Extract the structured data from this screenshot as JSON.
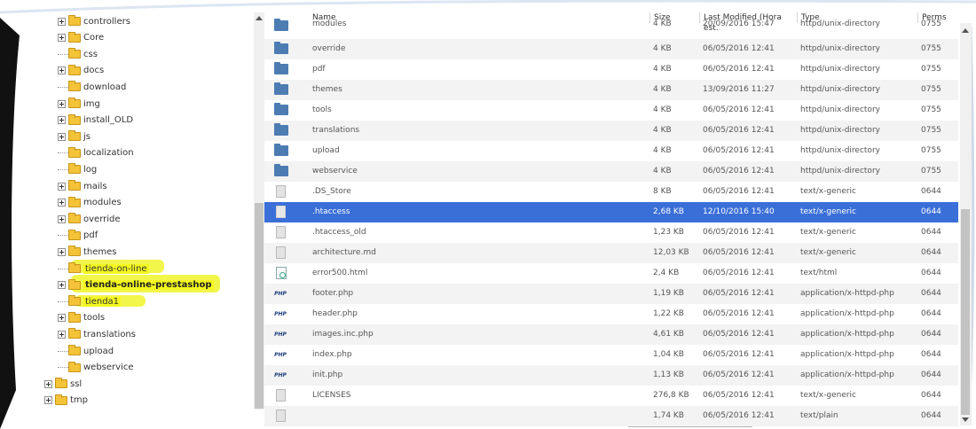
{
  "tree": {
    "items": [
      {
        "label": "controllers",
        "expandable": true,
        "state": "normal"
      },
      {
        "label": "Core",
        "expandable": true,
        "state": "normal"
      },
      {
        "label": "css",
        "expandable": false,
        "state": "normal"
      },
      {
        "label": "docs",
        "expandable": true,
        "state": "normal"
      },
      {
        "label": "download",
        "expandable": false,
        "state": "normal"
      },
      {
        "label": "img",
        "expandable": true,
        "state": "normal"
      },
      {
        "label": "install_OLD",
        "expandable": true,
        "state": "normal"
      },
      {
        "label": "js",
        "expandable": true,
        "state": "normal"
      },
      {
        "label": "localization",
        "expandable": false,
        "state": "normal"
      },
      {
        "label": "log",
        "expandable": false,
        "state": "normal"
      },
      {
        "label": "mails",
        "expandable": true,
        "state": "normal"
      },
      {
        "label": "modules",
        "expandable": true,
        "state": "normal"
      },
      {
        "label": "override",
        "expandable": true,
        "state": "normal"
      },
      {
        "label": "pdf",
        "expandable": false,
        "state": "normal"
      },
      {
        "label": "themes",
        "expandable": true,
        "state": "normal"
      },
      {
        "label": "tienda-on-line",
        "expandable": false,
        "state": "highlighted"
      },
      {
        "label": "tienda-online-prestashop",
        "expandable": true,
        "state": "highlighted-bold"
      },
      {
        "label": "tienda1",
        "expandable": false,
        "state": "highlighted"
      },
      {
        "label": "tools",
        "expandable": true,
        "state": "normal"
      },
      {
        "label": "translations",
        "expandable": true,
        "state": "normal"
      },
      {
        "label": "upload",
        "expandable": false,
        "state": "normal"
      },
      {
        "label": "webservice",
        "expandable": false,
        "state": "normal"
      },
      {
        "label": "ssl",
        "expandable": true,
        "state": "normal"
      },
      {
        "label": "tmp",
        "expandable": true,
        "state": "normal"
      }
    ]
  },
  "table": {
    "headers": {
      "name": "Name",
      "size": "Size",
      "modified": "Last Modified (Hora est.",
      "type": "Type",
      "perms": "Perms"
    },
    "rows": [
      {
        "icon": "folder-icon",
        "name": "modules",
        "size": "4 KB",
        "modified": "20/09/2016 15:47",
        "type": "httpd/unix-directory",
        "perms": "0755"
      },
      {
        "icon": "folder-icon",
        "name": "override",
        "size": "4 KB",
        "modified": "06/05/2016 12:41",
        "type": "httpd/unix-directory",
        "perms": "0755"
      },
      {
        "icon": "folder-icon",
        "name": "pdf",
        "size": "4 KB",
        "modified": "06/05/2016 12:41",
        "type": "httpd/unix-directory",
        "perms": "0755"
      },
      {
        "icon": "folder-icon",
        "name": "themes",
        "size": "4 KB",
        "modified": "13/09/2016 11:27",
        "type": "httpd/unix-directory",
        "perms": "0755"
      },
      {
        "icon": "folder-icon",
        "name": "tools",
        "size": "4 KB",
        "modified": "06/05/2016 12:41",
        "type": "httpd/unix-directory",
        "perms": "0755"
      },
      {
        "icon": "folder-icon",
        "name": "translations",
        "size": "4 KB",
        "modified": "06/05/2016 12:41",
        "type": "httpd/unix-directory",
        "perms": "0755"
      },
      {
        "icon": "folder-icon",
        "name": "upload",
        "size": "4 KB",
        "modified": "06/05/2016 12:41",
        "type": "httpd/unix-directory",
        "perms": "0755"
      },
      {
        "icon": "folder-icon",
        "name": "webservice",
        "size": "4 KB",
        "modified": "06/05/2016 12:41",
        "type": "httpd/unix-directory",
        "perms": "0755"
      },
      {
        "icon": "text-file-icon",
        "name": ".DS_Store",
        "size": "8 KB",
        "modified": "06/05/2016 12:41",
        "type": "text/x-generic",
        "perms": "0644"
      },
      {
        "icon": "text-file-icon",
        "name": ".htaccess",
        "size": "2,68 KB",
        "modified": "12/10/2016 15:40",
        "type": "text/x-generic",
        "perms": "0644",
        "selected": true
      },
      {
        "icon": "text-file-icon",
        "name": ".htaccess_old",
        "size": "1,23 KB",
        "modified": "06/05/2016 12:41",
        "type": "text/x-generic",
        "perms": "0644"
      },
      {
        "icon": "text-file-icon",
        "name": "architecture.md",
        "size": "12,03 KB",
        "modified": "06/05/2016 12:41",
        "type": "text/x-generic",
        "perms": "0644"
      },
      {
        "icon": "html-file-icon",
        "name": "error500.html",
        "size": "2,4 KB",
        "modified": "06/05/2016 12:41",
        "type": "text/html",
        "perms": "0644"
      },
      {
        "icon": "php-file-icon",
        "name": "footer.php",
        "size": "1,19 KB",
        "modified": "06/05/2016 12:41",
        "type": "application/x-httpd-php",
        "perms": "0644"
      },
      {
        "icon": "php-file-icon",
        "name": "header.php",
        "size": "1,22 KB",
        "modified": "06/05/2016 12:41",
        "type": "application/x-httpd-php",
        "perms": "0644"
      },
      {
        "icon": "php-file-icon",
        "name": "images.inc.php",
        "size": "4,61 KB",
        "modified": "06/05/2016 12:41",
        "type": "application/x-httpd-php",
        "perms": "0644"
      },
      {
        "icon": "php-file-icon",
        "name": "index.php",
        "size": "1,04 KB",
        "modified": "06/05/2016 12:41",
        "type": "application/x-httpd-php",
        "perms": "0644"
      },
      {
        "icon": "php-file-icon",
        "name": "init.php",
        "size": "1,13 KB",
        "modified": "06/05/2016 12:41",
        "type": "application/x-httpd-php",
        "perms": "0644"
      },
      {
        "icon": "text-file-icon",
        "name": "LICENSES",
        "size": "276,8 KB",
        "modified": "06/05/2016 12:41",
        "type": "text/x-generic",
        "perms": "0644"
      },
      {
        "icon": "text-file-icon",
        "name": "",
        "size": "1,74 KB",
        "modified": "06/05/2016 12:41",
        "type": "text/plain",
        "perms": "0644"
      }
    ]
  },
  "php_icon_text": "PHP",
  "colors": {
    "selection": "#3b6fd8",
    "highlight": "#f3f71f",
    "folder_yellow": "#f4c338",
    "folder_blue": "#4d7cb3"
  }
}
